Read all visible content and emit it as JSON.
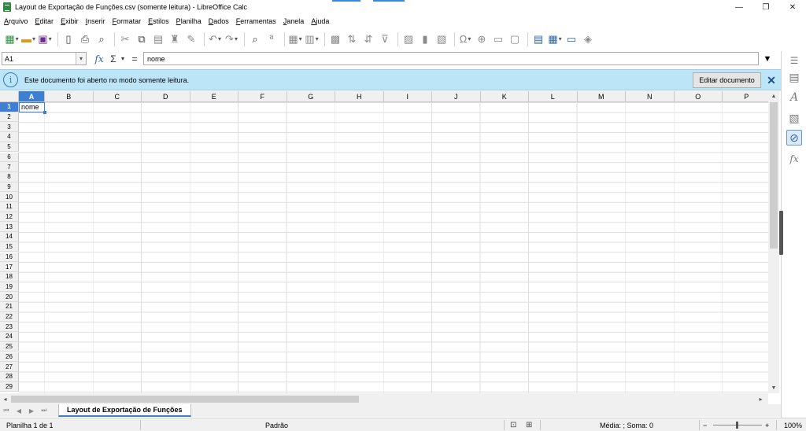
{
  "window": {
    "title": "Layout de Exportação de Funções.csv (somente leitura) - LibreOffice Calc",
    "controls": [
      "—",
      "❐",
      "✕"
    ]
  },
  "menu": [
    "Arquivo",
    "Editar",
    "Exibir",
    "Inserir",
    "Formatar",
    "Estilos",
    "Planilha",
    "Dados",
    "Ferramentas",
    "Janela",
    "Ajuda"
  ],
  "formula_bar": {
    "name_box": "A1",
    "fx_symbol": "fx",
    "sum_symbol": "Σ",
    "equals_symbol": "=",
    "content": "nome"
  },
  "infobar": {
    "message": "Este documento foi aberto no modo somente leitura.",
    "edit_button": "Editar documento",
    "close": "✕"
  },
  "sheet": {
    "columns": [
      "A",
      "B",
      "C",
      "D",
      "E",
      "F",
      "G",
      "H",
      "I",
      "J",
      "K",
      "L",
      "M",
      "N",
      "O",
      "P"
    ],
    "rows": [
      "1",
      "2",
      "3",
      "4",
      "5",
      "6",
      "7",
      "8",
      "9",
      "10",
      "11",
      "12",
      "13",
      "14",
      "15",
      "16",
      "17",
      "18",
      "19",
      "20",
      "21",
      "22",
      "23",
      "24",
      "25",
      "26",
      "27",
      "28",
      "29"
    ],
    "selected_cell": "A1",
    "cells": {
      "A1": "nome"
    }
  },
  "tabs": {
    "sheets": [
      "Layout de Exportação de Funções"
    ]
  },
  "status": {
    "sheet_info": "Planilha 1 de 1",
    "page_style": "Padrão",
    "aggregate": "Média: ; Soma: 0",
    "zoom": "100%",
    "zoom_minus": "−",
    "zoom_plus": "+"
  },
  "colors": {
    "accent": "#3e7fd2",
    "infobar_bg": "#bde5f8",
    "app_green": "#2e8b3e"
  }
}
